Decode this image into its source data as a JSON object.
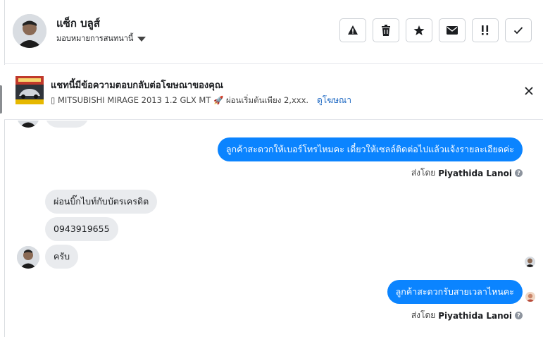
{
  "header": {
    "contact_name": "แซ็ก บลูส์",
    "assign_label": "มอบหมายการสนทนานี้",
    "actions": [
      {
        "icon": "warning-icon"
      },
      {
        "icon": "trash-icon"
      },
      {
        "icon": "star-icon"
      },
      {
        "icon": "mail-icon"
      },
      {
        "icon": "follow-up-icon"
      },
      {
        "icon": "check-icon"
      }
    ]
  },
  "banner": {
    "title": "แชทนี้มีข้อความตอบกลับต่อโฆษณาของคุณ",
    "description": "▯ MITSUBISHI MIRAGE 2013 1.2 GLX MT 🚀 ผ่อนเริ่มต้นเพียง 2,xxx. บา...",
    "link": "ดูโฆษณา"
  },
  "messages": [
    {
      "direction": "out",
      "text": "ลูกค้าสะดวกให้เบอร์โทรไหมคะ เดี๋ยวให้เซลล์ติดต่อไปแล้วแจ้งรายละเอียดค่ะ"
    },
    {
      "direction": "in",
      "text": "ผ่อนบิ๊กไบท์กับบัตรเครดิต"
    },
    {
      "direction": "in",
      "text": "0943919655"
    },
    {
      "direction": "in",
      "text": "ครับ"
    },
    {
      "direction": "out",
      "text": "ลูกค้าสะดวกรับสายเวลาไหนคะ"
    }
  ],
  "sent_by": {
    "prefix": "ส่งโดย",
    "agent": "Piyathida Lanoi"
  },
  "colors": {
    "outgoing_bubble": "#0b84ff",
    "incoming_bubble": "#e9ebee",
    "link": "#1a66c2"
  }
}
